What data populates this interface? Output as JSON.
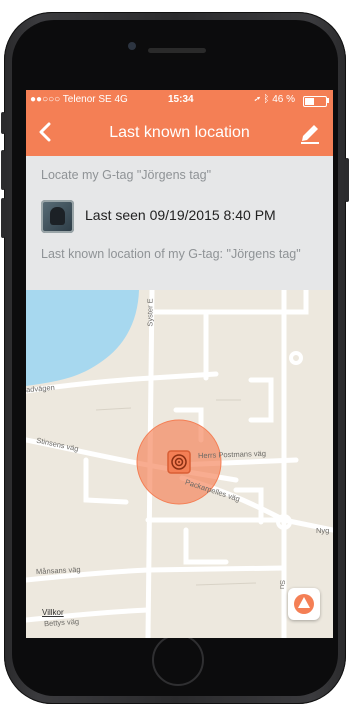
{
  "status_bar": {
    "carrier": "●●○○○ Telenor SE  4G",
    "time": "15:34",
    "battery": "46 %",
    "battery_level": 0.46
  },
  "nav": {
    "back_icon": "chevron-left-icon",
    "title": "Last known location",
    "edit_icon": "pencil-icon"
  },
  "info": {
    "locate_text": "Locate my G-tag \"Jörgens tag\"",
    "last_seen": "Last seen 09/19/2015 8:40 PM",
    "last_known_text": "Last known location of my G-tag: \"Jörgens tag\""
  },
  "map": {
    "street_labels": {
      "adv": "advägen",
      "stinsens": "Stinsens väg",
      "postmans": "Herrs Postmans väg",
      "packar": "Packarpelles väg",
      "syster": "Syster E",
      "nyg": "Nyg",
      "mansans": "Månsans väg",
      "bettys": "Bettys väg",
      "right_vert": "Su"
    },
    "terms_link": "Villkor",
    "locate_button_icon": "navigation-arrow-icon",
    "marker_icon": "target-icon"
  },
  "colors": {
    "accent": "#f47f55",
    "water": "#a7d8ef",
    "map_bg": "#ede8de",
    "road": "#ffffff"
  }
}
